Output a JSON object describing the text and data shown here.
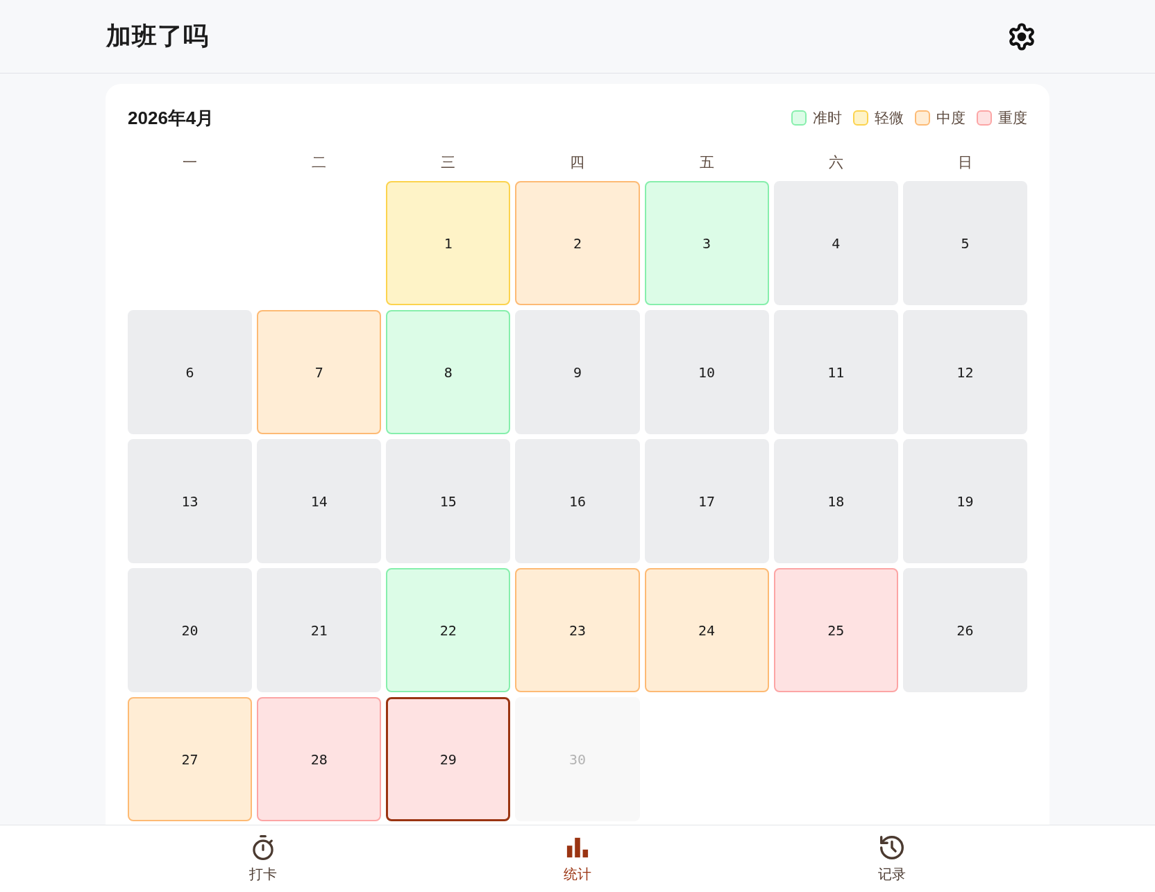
{
  "header": {
    "title": "加班了吗"
  },
  "calendar": {
    "month": "2026年4月",
    "legend": [
      {
        "label": "准时",
        "kind": "ontime"
      },
      {
        "label": "轻微",
        "kind": "mild"
      },
      {
        "label": "中度",
        "kind": "moderate"
      },
      {
        "label": "重度",
        "kind": "severe"
      }
    ],
    "weekdays": [
      "一",
      "二",
      "三",
      "四",
      "五",
      "六",
      "日"
    ],
    "weeks": [
      {
        "days": [
          {
            "day": "1",
            "kind": "mild",
            "selected": false
          },
          {
            "day": "2",
            "kind": "moderate",
            "selected": false
          },
          {
            "day": "3",
            "kind": "ontime",
            "selected": false
          },
          {
            "day": "4",
            "kind": "none",
            "selected": false
          },
          {
            "day": "5",
            "kind": "none",
            "selected": false
          }
        ]
      },
      {
        "days": [
          {
            "day": "6",
            "kind": "none",
            "selected": false
          },
          {
            "day": "7",
            "kind": "moderate",
            "selected": false
          },
          {
            "day": "8",
            "kind": "ontime",
            "selected": false
          },
          {
            "day": "9",
            "kind": "none",
            "selected": false
          },
          {
            "day": "10",
            "kind": "none",
            "selected": false
          },
          {
            "day": "11",
            "kind": "none",
            "selected": false
          },
          {
            "day": "12",
            "kind": "none",
            "selected": false
          }
        ]
      },
      {
        "days": [
          {
            "day": "13",
            "kind": "none",
            "selected": false
          },
          {
            "day": "14",
            "kind": "none",
            "selected": false
          },
          {
            "day": "15",
            "kind": "none",
            "selected": false
          },
          {
            "day": "16",
            "kind": "none",
            "selected": false
          },
          {
            "day": "17",
            "kind": "none",
            "selected": false
          },
          {
            "day": "18",
            "kind": "none",
            "selected": false
          },
          {
            "day": "19",
            "kind": "none",
            "selected": false
          }
        ]
      },
      {
        "days": [
          {
            "day": "20",
            "kind": "none",
            "selected": false
          },
          {
            "day": "21",
            "kind": "none",
            "selected": false
          },
          {
            "day": "22",
            "kind": "ontime",
            "selected": false
          },
          {
            "day": "23",
            "kind": "moderate",
            "selected": false
          },
          {
            "day": "24",
            "kind": "moderate",
            "selected": false
          },
          {
            "day": "25",
            "kind": "severe",
            "selected": false
          },
          {
            "day": "26",
            "kind": "none",
            "selected": false
          }
        ]
      },
      {
        "days": [
          {
            "day": "27",
            "kind": "moderate",
            "selected": false
          },
          {
            "day": "28",
            "kind": "severe",
            "selected": false
          },
          {
            "day": "29",
            "kind": "severe",
            "selected": true
          },
          {
            "day": "30",
            "kind": "future",
            "selected": false
          }
        ]
      }
    ]
  },
  "nav": [
    {
      "label": "打卡",
      "kind": "stopwatch",
      "selected": false
    },
    {
      "label": "统计",
      "kind": "chart",
      "selected": true
    },
    {
      "label": "记录",
      "kind": "history",
      "selected": false
    }
  ]
}
